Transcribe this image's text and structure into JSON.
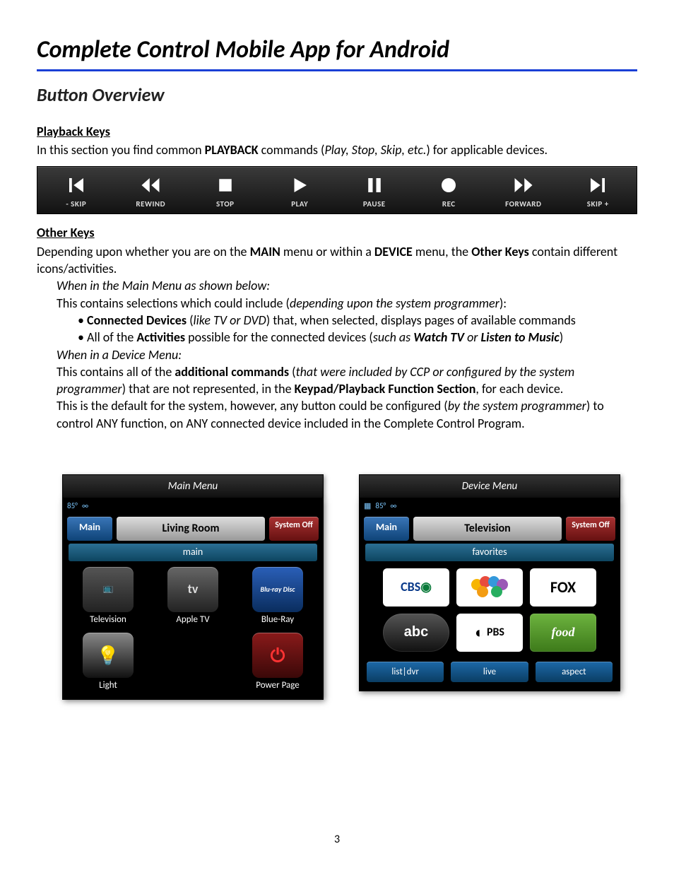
{
  "title": "Complete Control Mobile App for Android",
  "subtitle": "Button Overview",
  "page_number": "3",
  "playback": {
    "heading": "Playback Keys",
    "intro_a": "In this section you find common ",
    "intro_b": "PLAYBACK",
    "intro_c": " commands (",
    "intro_d": "Play, Stop, Skip, etc.",
    "intro_e": ") for applicable devices.",
    "keys": [
      {
        "label": "- SKIP"
      },
      {
        "label": "REWIND"
      },
      {
        "label": "STOP"
      },
      {
        "label": "PLAY"
      },
      {
        "label": "PAUSE"
      },
      {
        "label": "REC"
      },
      {
        "label": "FORWARD"
      },
      {
        "label": "SKIP +"
      }
    ]
  },
  "other": {
    "heading": "Other Keys",
    "p1_a": "Depending upon whether you are on the ",
    "p1_b": "MAIN",
    "p1_c": " menu or within a ",
    "p1_d": "DEVICE",
    "p1_e": " menu, the ",
    "p1_f": "Other Keys",
    "p1_g": " contain different icons/activities.",
    "main_header": "When in the Main Menu as shown below:",
    "main_line_a": "This contains selections which could include (",
    "main_line_b": "depending upon the system programmer",
    "main_line_c": "):",
    "bullet1_a": "Connected Devices",
    "bullet1_b": " (",
    "bullet1_c": "like TV or DVD",
    "bullet1_d": ") that, when selected, displays pages of available commands",
    "bullet2_a": "• All of the ",
    "bullet2_b": "Activities",
    "bullet2_c": " possible for the connected devices (",
    "bullet2_d": "such as ",
    "bullet2_e": "Watch TV",
    "bullet2_f": " or ",
    "bullet2_g": "Listen to Music",
    "bullet2_h": ")",
    "device_header": "When in a Device Menu:",
    "p2_a": "This contains all of the ",
    "p2_b": "additional commands",
    "p2_c": " (",
    "p2_d": "that were included by CCP or configured by the system programmer",
    "p2_e": ") that are not represented, in the ",
    "p2_f": "Keypad/Playback Function Section",
    "p2_g": ", for each device.",
    "p3_a": "This is the default for the system, however, any button could be configured (",
    "p3_b": "by the system programmer",
    "p3_c": ") to control ANY function, on ANY connected device included in the Complete Control Program."
  },
  "mainmenu": {
    "caption": "Main Menu",
    "temp": "85°",
    "main_btn": "Main",
    "room": "Living Room",
    "sysoff": "System Off",
    "sub": "main",
    "tiles": {
      "tv": "Television",
      "appletv": "Apple TV",
      "bluray": "Blue-Ray",
      "light": "Light",
      "power": "Power Page"
    }
  },
  "devicemenu": {
    "caption": "Device Menu",
    "temp": "85°",
    "main_btn": "Main",
    "room": "Television",
    "sysoff": "System Off",
    "sub": "favorites",
    "channels": {
      "cbs": "CBS",
      "nbc": "NBC",
      "fox": "FOX",
      "abc": "abc",
      "pbs": "PBS",
      "food": "food"
    },
    "bottom": {
      "listdvr": "list|dvr",
      "live": "live",
      "aspect": "aspect"
    }
  }
}
